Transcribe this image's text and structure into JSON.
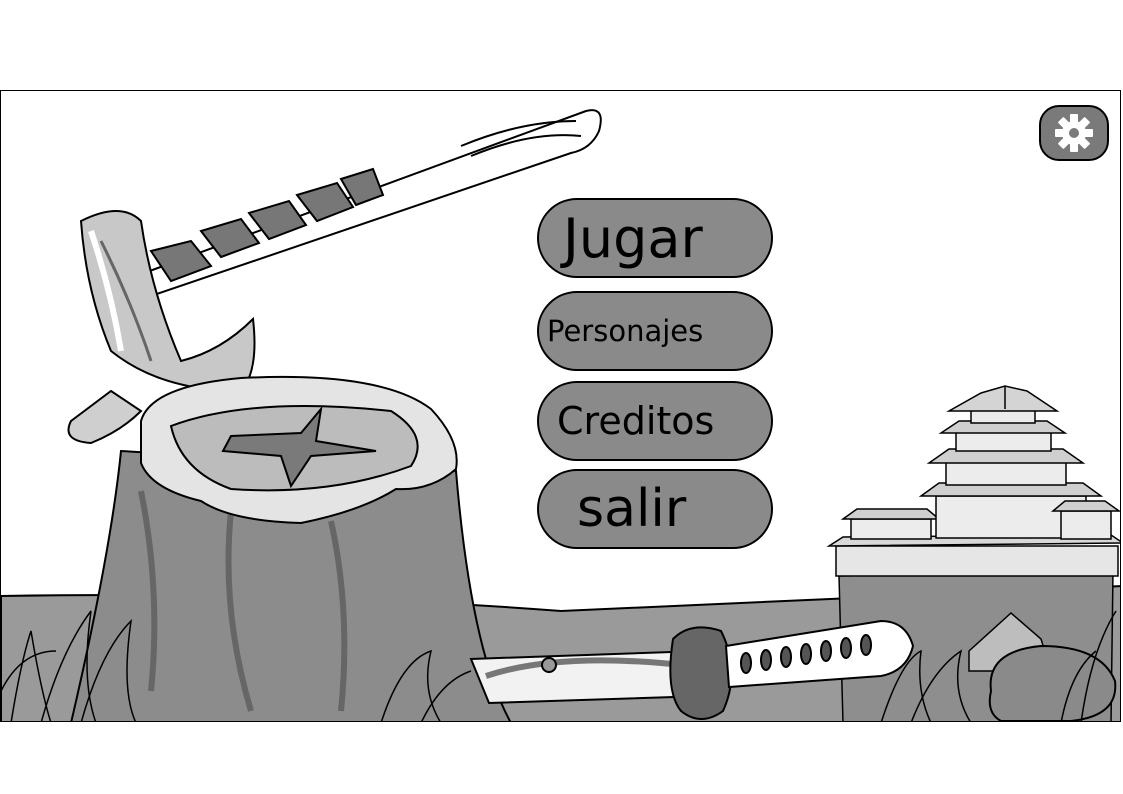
{
  "menu": {
    "play_label": "Jugar",
    "characters_label": "Personajes",
    "credits_label": "Creditos",
    "exit_label": "salir"
  },
  "settings": {
    "icon": "gear-icon"
  },
  "colors": {
    "button_fill": "#8a8a8a",
    "gear_button_fill": "#7a7a7a",
    "ground": "#9a9a9a",
    "stump": "#8c8c8c"
  }
}
